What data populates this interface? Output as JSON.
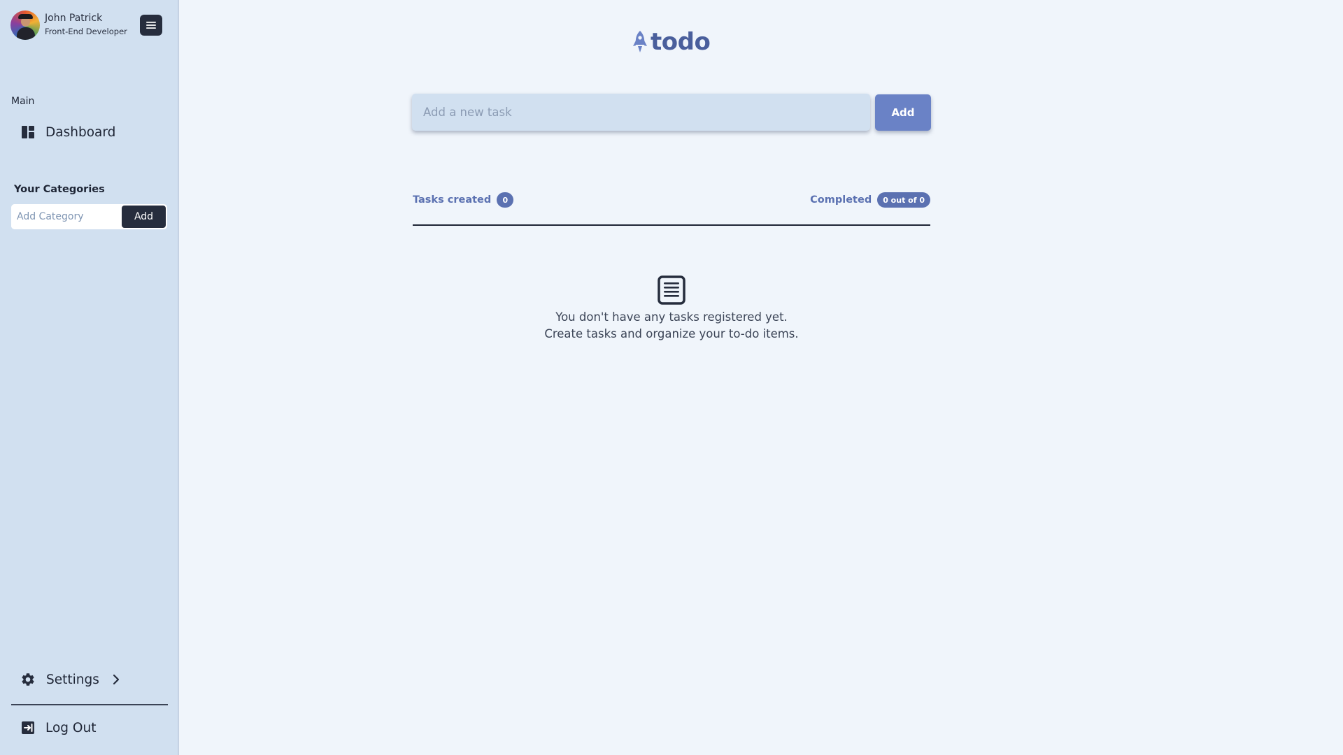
{
  "sidebar": {
    "profile": {
      "name": "John Patrick",
      "role": "Front-End Developer"
    },
    "main_section_label": "Main",
    "nav": {
      "dashboard": "Dashboard"
    },
    "categories": {
      "label": "Your Categories",
      "input_placeholder": "Add Category",
      "add_label": "Add"
    },
    "settings_label": "Settings",
    "logout_label": "Log Out"
  },
  "main": {
    "logo_text": "todo",
    "task_input_placeholder": "Add a new task",
    "add_button_label": "Add",
    "tasks_created": {
      "label": "Tasks created",
      "count": "0"
    },
    "completed": {
      "label": "Completed",
      "count": "0 out of 0"
    },
    "empty_state": {
      "line1": "You don't have any tasks registered yet.",
      "line2": "Create tasks and organize your to-do items."
    }
  },
  "colors": {
    "sidebar_bg": "#d1e0f0",
    "page_bg": "#f0f5fb",
    "accent": "#6a82c6",
    "dark": "#262d3d"
  },
  "icons": [
    "hamburger-menu-icon",
    "dashboard-icon",
    "gear-icon",
    "chevron-right-icon",
    "logout-icon",
    "rocket-icon",
    "clipboard-list-icon"
  ]
}
